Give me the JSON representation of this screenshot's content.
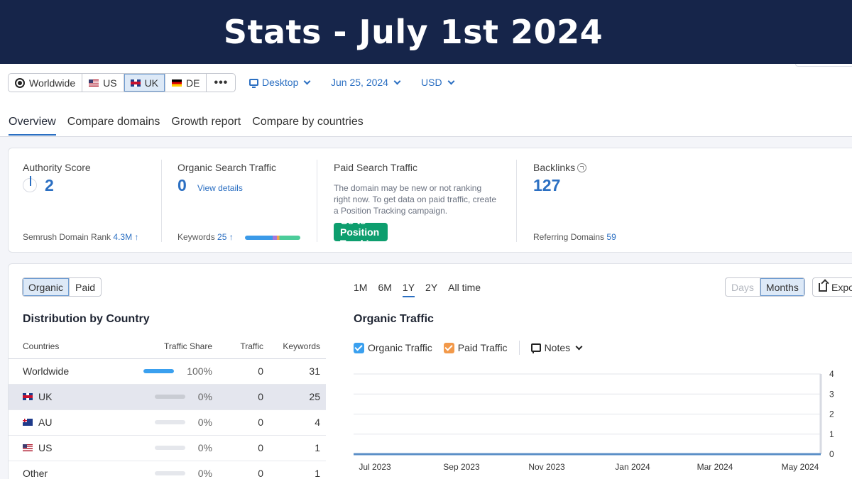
{
  "banner": {
    "title": "Stats - July 1st 2024"
  },
  "regions": [
    {
      "label": "Worldwide",
      "icon": "globe-icon",
      "active": false
    },
    {
      "label": "US",
      "icon": "us-flag-icon",
      "active": false
    },
    {
      "label": "UK",
      "icon": "uk-flag-icon",
      "active": true
    },
    {
      "label": "DE",
      "icon": "de-flag-icon",
      "active": false
    }
  ],
  "more_label": "•••",
  "device": "Desktop",
  "date": "Jun 25, 2024",
  "currency": "USD",
  "tabs": [
    {
      "label": "Overview",
      "active": true
    },
    {
      "label": "Compare domains",
      "active": false
    },
    {
      "label": "Growth report",
      "active": false
    },
    {
      "label": "Compare by countries",
      "active": false
    }
  ],
  "metrics": {
    "authority": {
      "title": "Authority Score",
      "value": "2",
      "foot_label": "Semrush Domain Rank",
      "foot_value": "4.3M ↑"
    },
    "organic": {
      "title": "Organic Search Traffic",
      "value": "0",
      "link": "View details",
      "foot_label": "Keywords",
      "foot_value": "25 ↑"
    },
    "paid": {
      "title": "Paid Search Traffic",
      "description": "The domain may be new or not ranking right now. To get data on paid traffic, create a Position Tracking campaign.",
      "button": "Go to Position Tracking"
    },
    "backlinks": {
      "title": "Backlinks",
      "value": "127",
      "foot_label": "Referring Domains",
      "foot_value": "59"
    }
  },
  "dist": {
    "toggle": [
      "Organic",
      "Paid"
    ],
    "title": "Distribution by Country",
    "headers": [
      "Countries",
      "Traffic Share",
      "Traffic",
      "Keywords"
    ],
    "rows": [
      {
        "country": "Worldwide",
        "flag": "none",
        "share": "100%",
        "share_value": 1.0,
        "traffic": "0",
        "keywords": "31",
        "highlight": false,
        "link": false
      },
      {
        "country": "UK",
        "flag": "uk-flag-icon",
        "share": "0%",
        "share_value": 0,
        "traffic": "0",
        "keywords": "25",
        "highlight": true,
        "link": true
      },
      {
        "country": "AU",
        "flag": "au-flag-icon",
        "share": "0%",
        "share_value": 0,
        "traffic": "0",
        "keywords": "4",
        "highlight": false,
        "link": true
      },
      {
        "country": "US",
        "flag": "us-flag-icon",
        "share": "0%",
        "share_value": 0,
        "traffic": "0",
        "keywords": "1",
        "highlight": false,
        "link": true
      },
      {
        "country": "Other",
        "flag": "none",
        "share": "0%",
        "share_value": 0,
        "traffic": "0",
        "keywords": "1",
        "highlight": false,
        "link": false
      }
    ]
  },
  "periods": [
    {
      "label": "1M",
      "active": false
    },
    {
      "label": "6M",
      "active": false
    },
    {
      "label": "1Y",
      "active": true
    },
    {
      "label": "2Y",
      "active": false
    },
    {
      "label": "All time",
      "active": false
    }
  ],
  "granularity": {
    "days": "Days",
    "months": "Months"
  },
  "export_label": "Expo",
  "traffic_chart": {
    "title": "Organic Traffic",
    "legend": [
      {
        "label": "Organic Traffic",
        "color": "#3aa0ef"
      },
      {
        "label": "Paid Traffic",
        "color": "#f2994a"
      }
    ],
    "notes_label": "Notes"
  },
  "chart_data": {
    "type": "line",
    "x_ticks": [
      "Jul 2023",
      "Sep 2023",
      "Nov 2023",
      "Jan 2024",
      "Mar 2024",
      "May 2024"
    ],
    "y_ticks": [
      "0",
      "1",
      "2",
      "3",
      "4"
    ],
    "ylim": [
      0,
      4
    ],
    "series": [
      {
        "name": "Organic Traffic",
        "values": [
          0,
          0,
          0,
          0,
          0,
          0,
          0,
          0,
          0,
          0,
          0,
          0
        ]
      },
      {
        "name": "Paid Traffic",
        "values": [
          0,
          0,
          0,
          0,
          0,
          0,
          0,
          0,
          0,
          0,
          0,
          0
        ]
      }
    ]
  }
}
